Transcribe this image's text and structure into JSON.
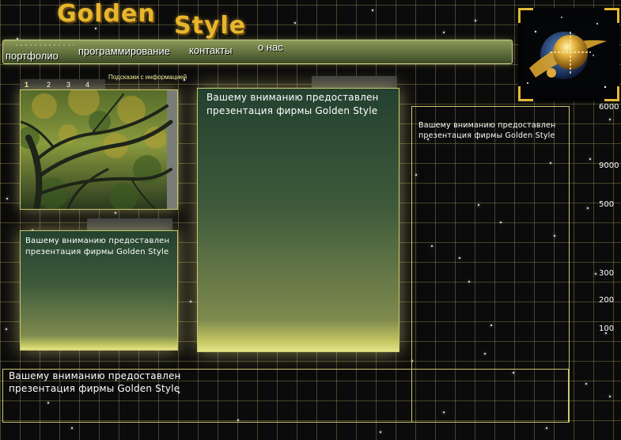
{
  "header": {
    "title_word_1": "Golden",
    "title_word_2": "Style"
  },
  "nav": {
    "items": [
      {
        "label": "портфолио"
      },
      {
        "label": "программирование"
      },
      {
        "label": "контакты"
      },
      {
        "label": "о нас"
      }
    ]
  },
  "gallery": {
    "tabs": [
      "1",
      "2",
      "3",
      "4"
    ],
    "active_tab": "1",
    "hint": "Подсказки с информацией"
  },
  "panels": {
    "small_text_line1": "Вашему вниманию предоставлен",
    "small_text_line2": "презентация фирмы Golden Style",
    "center_text_line1": "Вашему вниманию предоставлен",
    "center_text_line2": "презентация фирмы Golden Style",
    "right_text_line1": "Вашему вниманию предоставлен",
    "right_text_line2": "презентация фирмы Golden Style",
    "bottom_text_line1": "Вашему вниманию предоставлен",
    "bottom_text_line2": "презентация фирмы Golden Style"
  },
  "side_numbers": [
    "6000",
    "9000",
    "500",
    "300",
    "200",
    "100"
  ],
  "colors": {
    "gold": "#e8b62c",
    "grid_line": "#c8be6e",
    "panel_glow": "#ebe68c",
    "background": "#0b0b0b"
  },
  "icons": {
    "logo": "golden-planet-icon"
  }
}
